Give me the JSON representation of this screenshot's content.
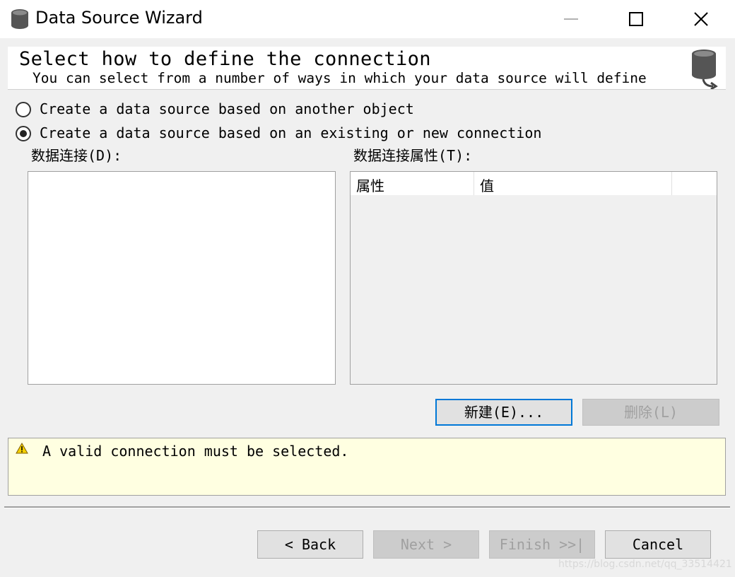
{
  "window": {
    "title": "Data Source Wizard",
    "icon": "database-icon"
  },
  "header": {
    "title": "Select how to define the connection",
    "subtitle": "You can select from a number of ways in which your data source will define",
    "icon": "database-arrow-icon"
  },
  "options": [
    {
      "label": "Create a data source based on another object",
      "selected": false
    },
    {
      "label": "Create a data source based on an existing or new connection",
      "selected": true
    }
  ],
  "connections": {
    "label": "数据连接(D):",
    "items": []
  },
  "properties": {
    "label": "数据连接属性(T):",
    "columns": [
      "属性",
      "值"
    ],
    "rows": []
  },
  "actions": {
    "new_label": "新建(E)...",
    "delete_label": "删除(L)"
  },
  "status": {
    "icon": "warning-icon",
    "message": "A valid connection must be selected."
  },
  "footer": {
    "back_label": "< Back",
    "next_label": "Next >",
    "finish_label": "Finish >>|",
    "cancel_label": "Cancel"
  },
  "watermark": "https://blog.csdn.net/qq_33514421",
  "colors": {
    "focus_border": "#0078d7",
    "warning_bg": "#ffffe1",
    "window_bg": "#f0f0f0"
  }
}
